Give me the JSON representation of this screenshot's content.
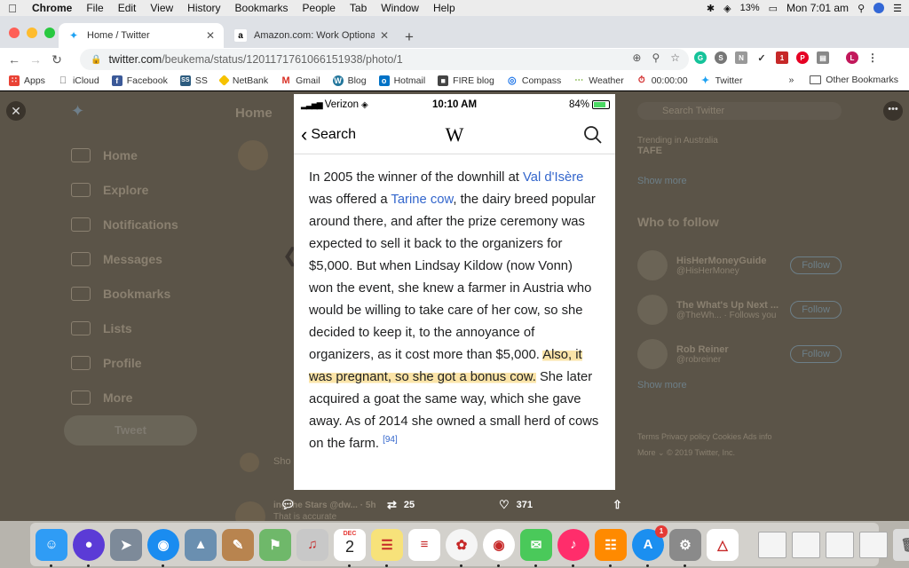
{
  "menubar": {
    "app": "Chrome",
    "items": [
      "File",
      "Edit",
      "View",
      "History",
      "Bookmarks",
      "People",
      "Tab",
      "Window",
      "Help"
    ],
    "battery": "13%",
    "clock": "Mon 7:01 am"
  },
  "tabs": [
    {
      "title": "Home / Twitter",
      "icon": "twitter-icon"
    },
    {
      "title": "Amazon.com: Work Optional: R",
      "icon": "amazon-icon"
    }
  ],
  "toolbar": {
    "url_host": "twitter.com",
    "url_path": "/beukema/status/1201171761066151938/photo/1"
  },
  "bookmarks": {
    "items": [
      {
        "label": "Apps",
        "icon": "apps-grid-icon",
        "color": "#e94235"
      },
      {
        "label": "iCloud",
        "icon": "apple-icon",
        "color": "#555555"
      },
      {
        "label": "Facebook",
        "icon": "facebook-icon",
        "color": "#3b5998"
      },
      {
        "label": "SS",
        "icon": "ss-icon",
        "color": "#2d5c7f"
      },
      {
        "label": "NetBank",
        "icon": "netbank-icon",
        "color": "#f6c200"
      },
      {
        "label": "Gmail",
        "icon": "gmail-icon",
        "color": "#d93025"
      },
      {
        "label": "Blog",
        "icon": "wordpress-icon",
        "color": "#21759b"
      },
      {
        "label": "Hotmail",
        "icon": "outlook-icon",
        "color": "#0072c6"
      },
      {
        "label": "FIRE blog",
        "icon": "fire-blog-icon",
        "color": "#444444"
      },
      {
        "label": "Compass",
        "icon": "compass-icon",
        "color": "#1a73e8"
      },
      {
        "label": "Weather",
        "icon": "weather-icon",
        "color": "#7cb342"
      },
      {
        "label": "00:00:00",
        "icon": "timer-icon",
        "color": "#d32f2f"
      },
      {
        "label": "Twitter",
        "icon": "twitter-icon",
        "color": "#1da1f2"
      }
    ],
    "overflow": "»",
    "other": "Other Bookmarks"
  },
  "twitter_bg": {
    "home": "Home",
    "nav": [
      "Home",
      "Explore",
      "Notifications",
      "Messages",
      "Bookmarks",
      "Lists",
      "Profile",
      "More"
    ],
    "tweet_button": "Tweet",
    "search_placeholder": "Search Twitter",
    "trending_label": "Trending in Australia",
    "trending_topic": "TAFE",
    "show_more": "Show more",
    "who_to_follow": "Who to follow",
    "follow": [
      {
        "name": "HisHerMoneyGuide",
        "handle": "@HisHerMoney"
      },
      {
        "name": "The What's Up Next ...",
        "handle": "@TheWh... · Follows you"
      },
      {
        "name": "Rob Reiner",
        "handle": "@robreiner"
      }
    ],
    "follow_label": "Follow",
    "show_more2": "Show more",
    "footer": "Terms  Privacy policy  Cookies  Ads info",
    "footer2": "More ⌄  © 2019 Twitter, Inc.",
    "reply_snippet": "Sho",
    "bottom_tweet": "ing the Stars @dw... · 5h",
    "bottom_tweet2": "That is accurate"
  },
  "phone": {
    "carrier": "Verizon",
    "time": "10:10 AM",
    "battery": "84%",
    "back_label": "Search",
    "logo": "W",
    "article": {
      "p1": "In 2005 the winner of the downhill at ",
      "link1": "Val d'Isère",
      "p2": " was offered a ",
      "link2": "Tarine cow",
      "p3": ", the dairy breed popular around there, and after the prize ceremony was expected to sell it back to the organizers for $5,000. But when Lindsay Kildow (now Vonn) won the event, she knew a farmer in Austria who would be willing to take care of her cow, so she decided to keep it, to the annoyance of organizers, as it cost more than $5,000. ",
      "highlight": "Also, it was pregnant, so she got a bonus cow.",
      "p4": " She later acquired a goat the same way, which she gave away. As of 2014 she owned a small herd of cows on the farm.",
      "ref": "[94]"
    }
  },
  "actions": {
    "retweets": "25",
    "likes": "371"
  },
  "dock": {
    "apps": [
      {
        "name": "finder-icon",
        "color": "#2f9cf5"
      },
      {
        "name": "siri-icon",
        "color": "#5b3bd6"
      },
      {
        "name": "launchpad-icon",
        "color": "#7d8a99"
      },
      {
        "name": "safari-icon",
        "color": "#1a8cf0"
      },
      {
        "name": "photo-app-icon",
        "color": "#6a8fb0"
      },
      {
        "name": "contacts-icon",
        "color": "#b8844f"
      },
      {
        "name": "maps-icon",
        "color": "#6fb86a"
      },
      {
        "name": "itunes-icon",
        "color": "#c8c8c8"
      },
      {
        "name": "calendar-icon",
        "color": "#ffffff"
      },
      {
        "name": "notes-icon",
        "color": "#f7e27a"
      },
      {
        "name": "reminders-icon",
        "color": "#ffffff"
      },
      {
        "name": "photos-icon",
        "color": "#f5f5f5"
      },
      {
        "name": "chrome-icon",
        "color": "#ffffff"
      },
      {
        "name": "messages-icon",
        "color": "#4ac95a"
      },
      {
        "name": "music-icon",
        "color": "#ff2d6b"
      },
      {
        "name": "books-icon",
        "color": "#ff8a00"
      },
      {
        "name": "app-store-icon",
        "color": "#1b8ff0"
      },
      {
        "name": "system-preferences-icon",
        "color": "#8a8a8a"
      },
      {
        "name": "acrobat-icon",
        "color": "#ffffff"
      }
    ],
    "calendar_month": "DEC",
    "calendar_day": "2",
    "app_store_badge": "1"
  }
}
